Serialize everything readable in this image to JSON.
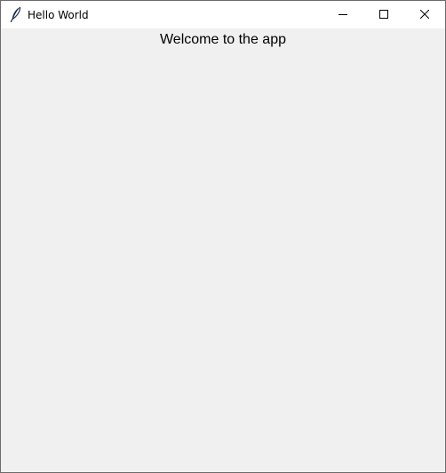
{
  "window": {
    "title": "Hello World",
    "icon": "feather-icon",
    "controls": {
      "minimize_icon": "minimize-icon",
      "maximize_icon": "maximize-icon",
      "close_icon": "close-icon"
    }
  },
  "content": {
    "welcome_text": "Welcome to the app"
  },
  "colors": {
    "titlebar": "#ffffff",
    "client_background": "#f0f0f0",
    "border": "#6b6b6b",
    "text": "#000000"
  }
}
